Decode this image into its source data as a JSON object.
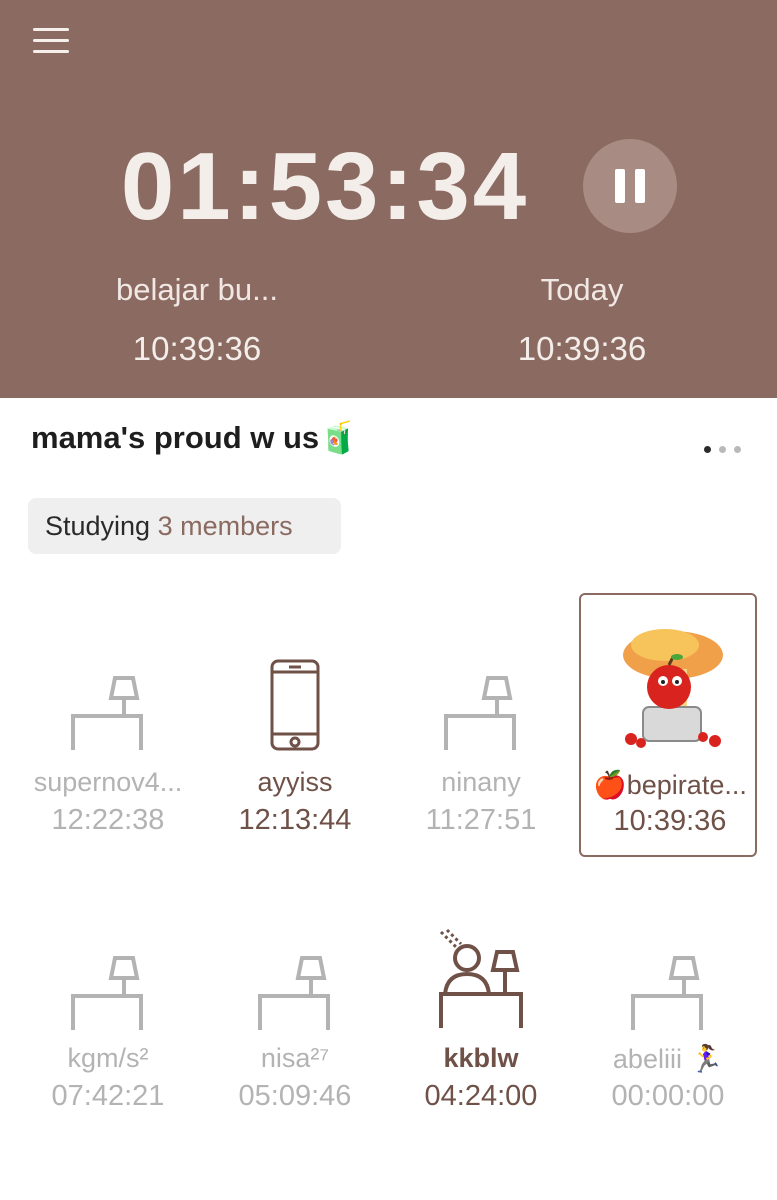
{
  "timer": {
    "display": "01:53:34"
  },
  "subject": {
    "label": "belajar bu...",
    "time": "10:39:36"
  },
  "today": {
    "label": "Today",
    "time": "10:39:36"
  },
  "group": {
    "title": "mama's proud w us🧃"
  },
  "status": {
    "label": "Studying",
    "count": "3 members"
  },
  "members": [
    {
      "name": "supernov4...",
      "time": "12:22:38",
      "state": "idle",
      "icon": "desk-lamp-icon"
    },
    {
      "name": "ayyiss",
      "time": "12:13:44",
      "state": "phone",
      "icon": "phone-icon"
    },
    {
      "name": "ninany",
      "time": "11:27:51",
      "state": "idle",
      "icon": "desk-lamp-icon"
    },
    {
      "name": "🍎bepirate...",
      "time": "10:39:36",
      "state": "me",
      "icon": "apple-avatar-icon"
    },
    {
      "name": "kgm/s²",
      "time": "07:42:21",
      "state": "idle",
      "icon": "desk-lamp-icon"
    },
    {
      "name": "nisa²⁷",
      "time": "05:09:46",
      "state": "idle",
      "icon": "desk-lamp-icon"
    },
    {
      "name": "kkblw",
      "time": "04:24:00",
      "state": "studying",
      "icon": "person-studying-icon"
    },
    {
      "name": "abeliii 🏃‍♀️",
      "time": "00:00:00",
      "state": "idle",
      "icon": "desk-lamp-icon"
    }
  ],
  "colors": {
    "header": "#8b6b61",
    "active": "#6f5148",
    "muted": "#b3b3b3"
  }
}
